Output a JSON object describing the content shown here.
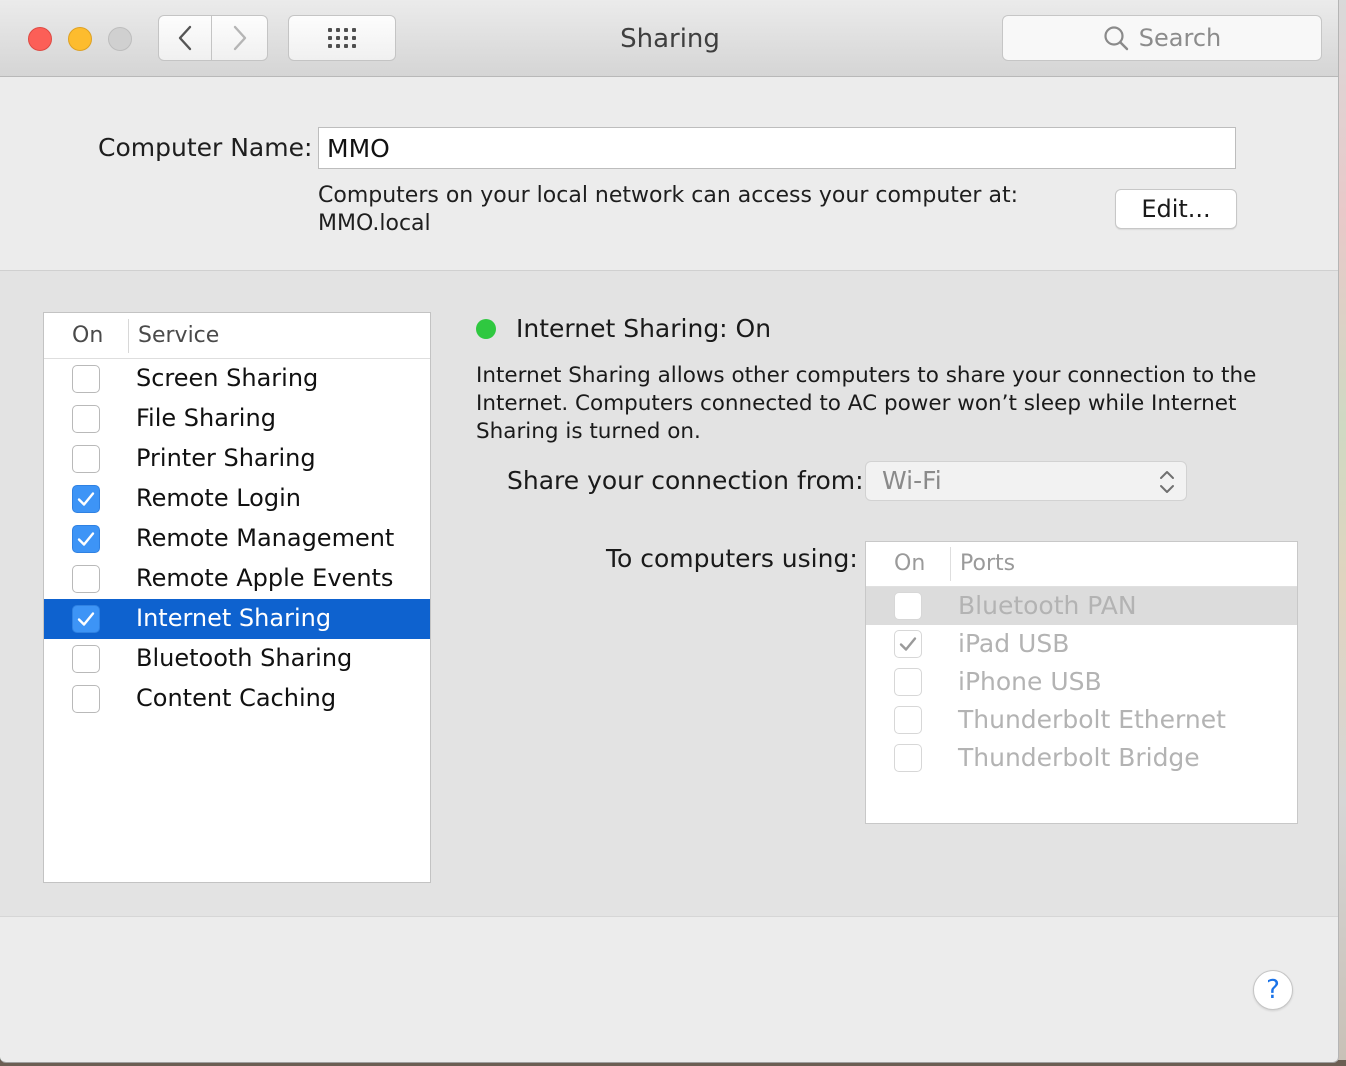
{
  "window": {
    "title": "Sharing"
  },
  "toolbar": {
    "search_placeholder": "Search"
  },
  "computer_name": {
    "label": "Computer Name:",
    "value": "MMO",
    "description_line1": "Computers on your local network can access your computer at:",
    "description_line2": "MMO.local",
    "edit_label": "Edit..."
  },
  "services": {
    "header_on": "On",
    "header_service": "Service",
    "items": [
      {
        "label": "Screen Sharing",
        "checked": false,
        "selected": false
      },
      {
        "label": "File Sharing",
        "checked": false,
        "selected": false
      },
      {
        "label": "Printer Sharing",
        "checked": false,
        "selected": false
      },
      {
        "label": "Remote Login",
        "checked": true,
        "selected": false
      },
      {
        "label": "Remote Management",
        "checked": true,
        "selected": false
      },
      {
        "label": "Remote Apple Events",
        "checked": false,
        "selected": false
      },
      {
        "label": "Internet Sharing",
        "checked": true,
        "selected": true
      },
      {
        "label": "Bluetooth Sharing",
        "checked": false,
        "selected": false
      },
      {
        "label": "Content Caching",
        "checked": false,
        "selected": false
      }
    ]
  },
  "detail": {
    "status_title": "Internet Sharing: On",
    "status_color": "#2fc840",
    "description": "Internet Sharing allows other computers to share your connection to the Internet. Computers connected to AC power won’t sleep while Internet Sharing is turned on.",
    "share_from_label": "Share your connection from:",
    "share_from_value": "Wi-Fi",
    "to_computers_label": "To computers using:",
    "ports_header_on": "On",
    "ports_header_ports": "Ports",
    "ports": [
      {
        "label": "Bluetooth PAN",
        "checked": false,
        "selected": true
      },
      {
        "label": "iPad USB",
        "checked": true,
        "selected": false
      },
      {
        "label": "iPhone USB",
        "checked": false,
        "selected": false
      },
      {
        "label": "Thunderbolt Ethernet",
        "checked": false,
        "selected": false
      },
      {
        "label": "Thunderbolt Bridge",
        "checked": false,
        "selected": false
      }
    ]
  },
  "help": {
    "label": "?"
  },
  "colors": {
    "selection": "#0e62cf",
    "checkbox_checked": "#3d94f6",
    "close": "#fc5f57",
    "minimize": "#fdbc2e"
  }
}
